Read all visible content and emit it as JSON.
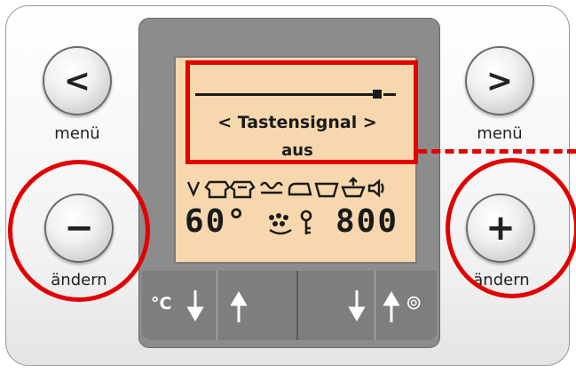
{
  "buttons": {
    "left_nav_symbol": "<",
    "left_nav_label": "menü",
    "right_nav_symbol": ">",
    "right_nav_label": "menü",
    "minus_symbol": "−",
    "minus_label": "ändern",
    "plus_symbol": "+",
    "plus_label": "ändern"
  },
  "display": {
    "menu_line": "< Tastensignal >",
    "menu_value": "aus",
    "temperature": "60°",
    "spin_speed": "800",
    "program_icons": [
      "cotton-icon",
      "shirt-icon",
      "shirt-easy-care-icon",
      "wool-icon",
      "iron-icon",
      "basin-icon",
      "rinse-icon",
      "speaker-icon"
    ]
  },
  "bottom_keys": {
    "temp_unit": "°C",
    "spiral_symbol": "⊚"
  },
  "annotation": {
    "highlight_color": "#e20000"
  }
}
